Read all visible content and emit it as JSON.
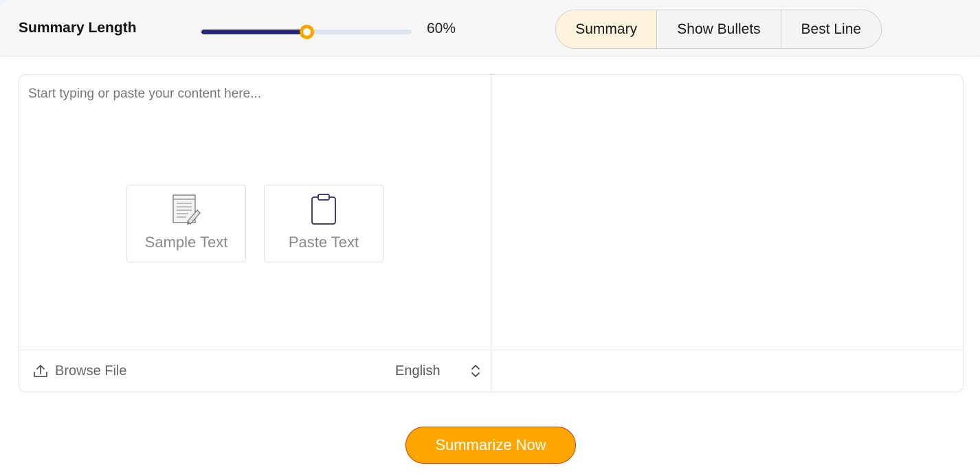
{
  "controls": {
    "length_label": "Summary Length",
    "length_value_text": "60%",
    "length_fraction": 0.5
  },
  "modes": [
    {
      "label": "Summary",
      "active": true
    },
    {
      "label": "Show Bullets",
      "active": false
    },
    {
      "label": "Best Line",
      "active": false
    }
  ],
  "input": {
    "placeholder": "Start typing or paste your content here...",
    "sample_label": "Sample Text",
    "paste_label": "Paste Text",
    "browse_label": "Browse File",
    "language": "English"
  },
  "action": {
    "summarize_label": "Summarize Now"
  },
  "colors": {
    "accent": "#ffa600",
    "slider_fill": "#26277a",
    "active_tab_bg": "#fdf2dc"
  },
  "icons": {
    "sample": "document-pencil-icon",
    "paste": "clipboard-icon",
    "upload": "upload-icon",
    "language": "chevron-up-down-icon"
  }
}
